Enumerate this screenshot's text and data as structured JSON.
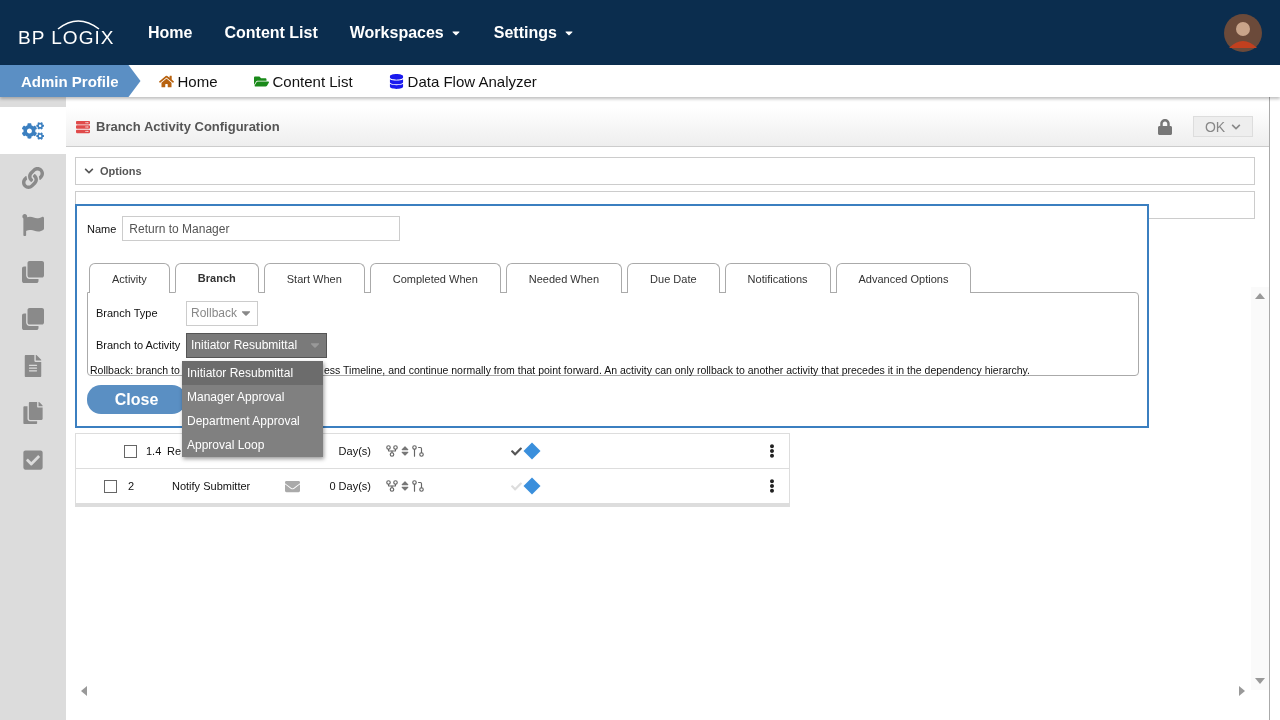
{
  "logo": "BP LOGIX",
  "top_nav": [
    {
      "label": "Home",
      "dropdown": false
    },
    {
      "label": "Content List",
      "dropdown": false
    },
    {
      "label": "Workspaces",
      "dropdown": true
    },
    {
      "label": "Settings",
      "dropdown": true
    }
  ],
  "breadcrumb": {
    "profile": "Admin Profile",
    "links": [
      {
        "label": "Home",
        "kind": "home"
      },
      {
        "label": "Content List",
        "kind": "folder"
      },
      {
        "label": "Data Flow Analyzer",
        "kind": "database"
      }
    ]
  },
  "sidebar": {
    "items": [
      {
        "kind": "gears",
        "selected": true
      },
      {
        "kind": "link",
        "selected": false
      },
      {
        "kind": "flag",
        "selected": false
      },
      {
        "kind": "squares",
        "selected": false
      },
      {
        "kind": "squares",
        "selected": false
      },
      {
        "kind": "file",
        "selected": false
      },
      {
        "kind": "pages",
        "selected": false
      },
      {
        "kind": "check",
        "selected": false
      }
    ]
  },
  "panel": {
    "title": "Branch Activity Configuration",
    "locked": true,
    "ok_button": "OK"
  },
  "sections": [
    {
      "label": "Options"
    }
  ],
  "dialog": {
    "name_label": "Name",
    "name_value": "Return to Manager",
    "tabs": [
      {
        "label": "Activity",
        "selected": false
      },
      {
        "label": "Branch",
        "selected": true
      },
      {
        "label": "Start When",
        "selected": false
      },
      {
        "label": "Completed When",
        "selected": false
      },
      {
        "label": "Needed When",
        "selected": false
      },
      {
        "label": "Due Date",
        "selected": false
      },
      {
        "label": "Notifications",
        "selected": false
      },
      {
        "label": "Advanced Options",
        "selected": false
      }
    ],
    "branch_type_label": "Branch Type",
    "branch_type_value": "Rollback",
    "branch_type_disabled": true,
    "branch_to_label": "Branch to Activity",
    "branch_to_value": "Initiator Resubmittal",
    "description_start": "Rollback: branch to",
    "description_end": "ess Timeline, and continue normally from that point forward. An activity can only rollback to another activity that precedes it in the dependency hierarchy.",
    "close_button": "Close",
    "menu": [
      {
        "label": "Initiator Resubmittal",
        "selected": true
      },
      {
        "label": "Manager Approval",
        "selected": false
      },
      {
        "label": "Department Approval",
        "selected": false
      },
      {
        "label": "Approval Loop",
        "selected": false
      }
    ]
  },
  "rows": [
    {
      "kind": "child",
      "checked": false,
      "number": "1.4",
      "name": "Re",
      "duration": "Day(s)",
      "done": true
    },
    {
      "kind": "top",
      "checked": false,
      "number": "2",
      "name": "Notify Submitter",
      "mail": true,
      "duration": "0 Day(s)",
      "done": false
    }
  ]
}
